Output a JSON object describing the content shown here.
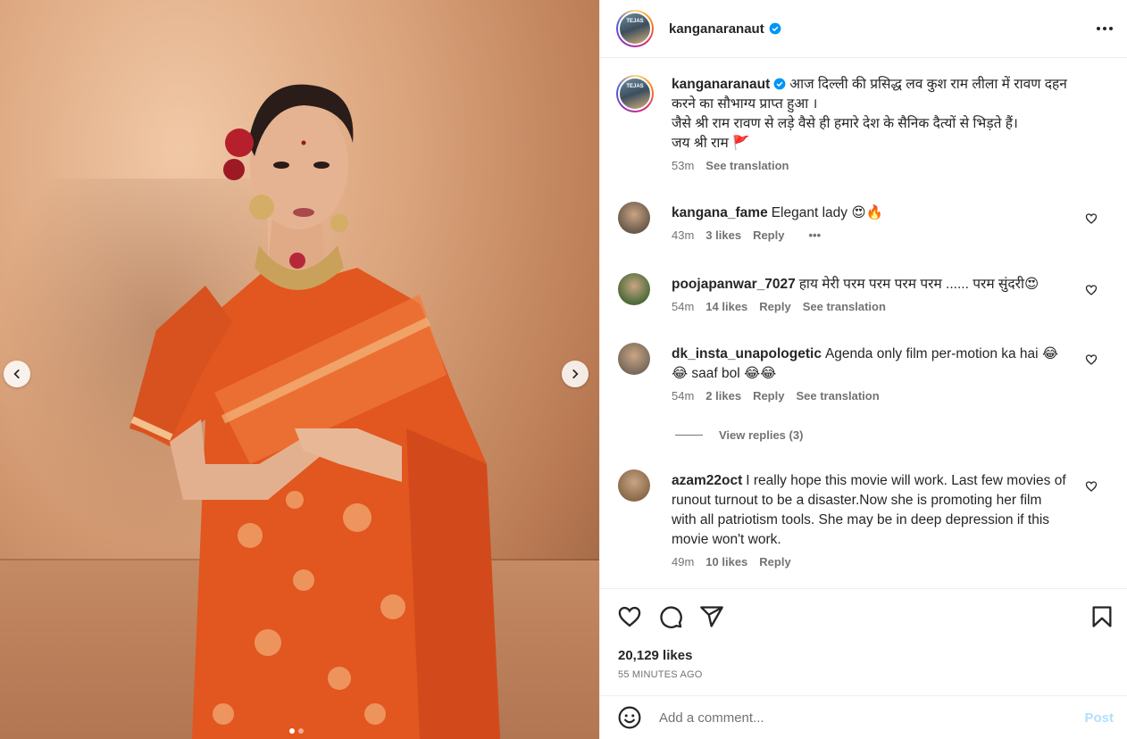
{
  "post": {
    "username": "kanganaranaut",
    "avatar_text": "TEJAS",
    "caption": "आज दिल्ली की प्रसिद्ध लव कुश राम लीला में रावण दहन करने का सौभाग्य प्राप्त हुआ ।\nजैसे श्री राम रावण से लड़े वैसे ही हमारे देश के सैनिक दैत्यों से भिड़ते हैं।\nजय श्री राम 🚩",
    "caption_time": "53m",
    "see_translation": "See translation",
    "likes": "20,129 likes",
    "time_ago": "55 MINUTES AGO"
  },
  "carousel": {
    "total": 2,
    "active": 1
  },
  "comments": [
    {
      "user": "kangana_fame",
      "text": "Elegant lady 😍🔥",
      "time": "43m",
      "likes": "3 likes",
      "reply": "Reply",
      "more": "•••",
      "avatar_color": "#6b5a4a"
    },
    {
      "user": "poojapanwar_7027",
      "text": "हाय मेरी परम परम परम परम ...... परम सुंदरी😍",
      "time": "54m",
      "likes": "14 likes",
      "reply": "Reply",
      "translation": "See translation",
      "avatar_color": "#4d6b3a"
    },
    {
      "user": "dk_insta_unapologetic",
      "text": "Agenda only film per-motion ka hai 😂 😂 saaf bol 😂😂",
      "time": "54m",
      "likes": "2 likes",
      "reply": "Reply",
      "translation": "See translation",
      "avatar_color": "#7a6a5a"
    },
    {
      "user": "azam22oct",
      "text": "I really hope this movie will work. Last few movies of runout turnout to be a disaster.Now she is promoting her film with all patriotism tools. She may be in deep depression if this movie won't work.",
      "time": "49m",
      "likes": "10 likes",
      "reply": "Reply",
      "avatar_color": "#8a6a4a"
    }
  ],
  "view_replies": "View replies (3)",
  "add_comment": {
    "placeholder": "Add a comment...",
    "post_label": "Post"
  },
  "icons": {
    "verified": "verified-badge-icon",
    "more": "more-options-icon",
    "like": "heart-icon",
    "comment": "comment-icon",
    "share": "share-icon",
    "save": "bookmark-icon",
    "emoji": "emoji-icon",
    "prev": "chevron-left-icon",
    "next": "chevron-right-icon"
  },
  "colors": {
    "verified": "#0095f6",
    "post_disabled": "#b2dffc",
    "saree": "#e2561f"
  }
}
